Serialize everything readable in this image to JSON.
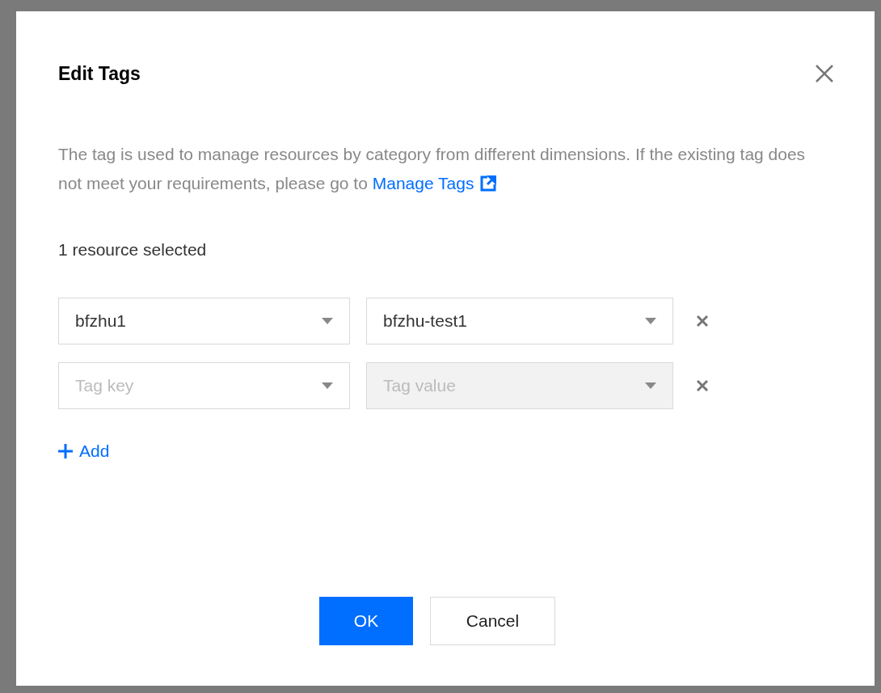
{
  "dialog": {
    "title": "Edit Tags",
    "description": "The tag is used to manage resources by category from different dimensions. If the existing tag does not meet your requirements, please go to",
    "link": "Manage Tags",
    "selection_count": "1 resource selected",
    "tag_rows": [
      {
        "key": {
          "value": "bfzhu1",
          "disabled": false
        },
        "value": {
          "value": "bfzhu-test1",
          "disabled": false
        }
      },
      {
        "key": {
          "placeholder": "Tag key",
          "disabled": false
        },
        "value": {
          "placeholder": "Tag value",
          "disabled": true
        }
      }
    ],
    "add_label": "Add",
    "buttons": [
      {
        "label": "OK",
        "kind": "primary"
      },
      {
        "label": "Cancel",
        "kind": "default"
      }
    ]
  }
}
